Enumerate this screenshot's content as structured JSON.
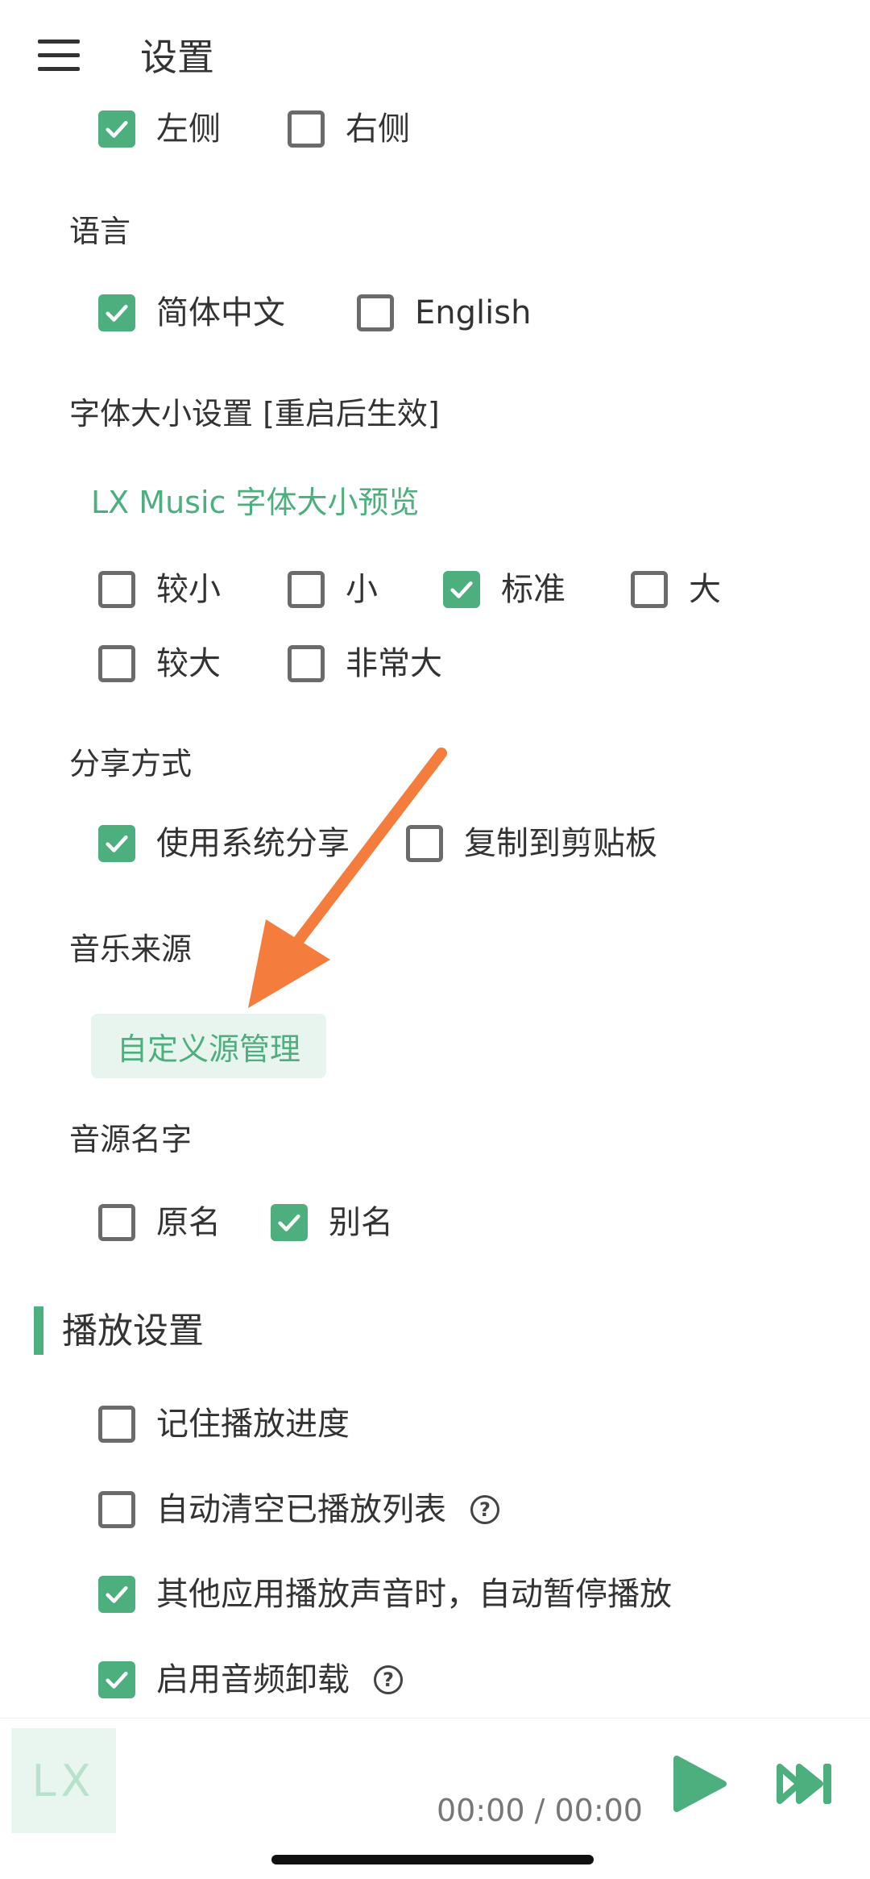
{
  "header": {
    "title": "设置"
  },
  "position": {
    "options": [
      {
        "label": "左侧",
        "checked": true
      },
      {
        "label": "右侧",
        "checked": false
      }
    ]
  },
  "language": {
    "label": "语言",
    "options": [
      {
        "label": "简体中文",
        "checked": true
      },
      {
        "label": "English",
        "checked": false
      }
    ]
  },
  "font_size": {
    "label": "字体大小设置 [重启后生效]",
    "preview": "LX Music 字体大小预览",
    "options": [
      {
        "label": "较小",
        "checked": false
      },
      {
        "label": "小",
        "checked": false
      },
      {
        "label": "标准",
        "checked": true
      },
      {
        "label": "大",
        "checked": false
      },
      {
        "label": "较大",
        "checked": false
      },
      {
        "label": "非常大",
        "checked": false
      }
    ]
  },
  "share": {
    "label": "分享方式",
    "options": [
      {
        "label": "使用系统分享",
        "checked": true
      },
      {
        "label": "复制到剪贴板",
        "checked": false
      }
    ]
  },
  "music_source": {
    "label": "音乐来源",
    "button": "自定义源管理"
  },
  "source_name": {
    "label": "音源名字",
    "options": [
      {
        "label": "原名",
        "checked": false
      },
      {
        "label": "别名",
        "checked": true
      }
    ]
  },
  "playback": {
    "title": "播放设置",
    "options": [
      {
        "label": "记住播放进度",
        "checked": false
      },
      {
        "label": "自动清空已播放列表",
        "checked": false
      },
      {
        "label": "其他应用播放声音时，自动暂停播放",
        "checked": true
      },
      {
        "label": "启用音频卸载",
        "checked": true
      }
    ]
  },
  "player": {
    "cover_text": "LX",
    "time": "00:00 / 00:00"
  },
  "colors": {
    "accent": "#4caf7d",
    "annotation_arrow": "#f47c3c"
  }
}
